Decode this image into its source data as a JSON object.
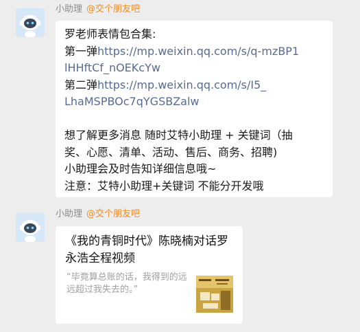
{
  "messages": [
    {
      "sender_name": "小助理",
      "sender_group": "@交个朋友吧",
      "lines": [
        {
          "text": "罗老师表情包合集:",
          "kind": "text"
        },
        {
          "text": "第一弹",
          "kind": "text",
          "link": "https://mp.weixin.qq.com/s/q-mzBP1"
        },
        {
          "text": "lHHftCf_nOEKcYw",
          "kind": "link"
        },
        {
          "text": "第二弹",
          "kind": "text",
          "link": "https://mp.weixin.qq.com/s/I5_"
        },
        {
          "text": "LhaMSPBOc7qYGSBZalw",
          "kind": "link"
        },
        {
          "text": "",
          "kind": "blank"
        },
        {
          "text": "想了解更多消息  随时艾特小助理 + 关键词（抽",
          "kind": "text"
        },
        {
          "text": "奖、心愿、清单、活动、售后、商务、招聘)",
          "kind": "text"
        },
        {
          "text": "小助理会及时告知详细信息哦~",
          "kind": "text"
        },
        {
          "text": "注意：艾特小助理+关键词 不能分开发哦",
          "kind": "text"
        }
      ]
    },
    {
      "sender_name": "小助理",
      "sender_group": "@交个朋友吧",
      "card": {
        "title": "《我的青铜时代》陈晓楠对话罗永浩全程视频",
        "description": "“毕竟算总账的话，我得到的远远超过我失去的。”"
      }
    }
  ],
  "colors": {
    "background": "#ededed",
    "bubble": "#ffffff",
    "link": "#576b95",
    "group_tag": "#f28a1e",
    "sender_name": "#8c8c8c"
  }
}
